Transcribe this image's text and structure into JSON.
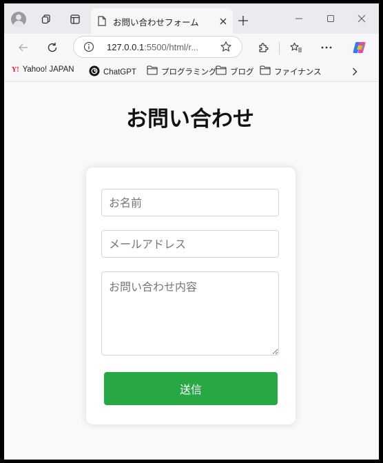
{
  "browser": {
    "tab": {
      "title": "お問い合わせフォーム"
    },
    "address": {
      "host": "127.0.0.1",
      "rest": ":5500/html/r..."
    },
    "bookmarks": [
      {
        "label": "Yahoo! JAPAN",
        "icon": "yahoo-icon"
      },
      {
        "label": "ChatGPT",
        "icon": "chatgpt-icon"
      },
      {
        "label": "プログラミング",
        "icon": "folder-icon"
      },
      {
        "label": "ブログ",
        "icon": "folder-icon"
      },
      {
        "label": "ファイナンス",
        "icon": "folder-icon"
      }
    ]
  },
  "page": {
    "title": "お問い合わせ",
    "form": {
      "name_placeholder": "お名前",
      "email_placeholder": "メールアドレス",
      "message_placeholder": "お問い合わせ内容",
      "submit_label": "送信"
    }
  },
  "colors": {
    "submit_button": "#28a745",
    "page_background": "#f9f8fa",
    "card_background": "#ffffff"
  }
}
